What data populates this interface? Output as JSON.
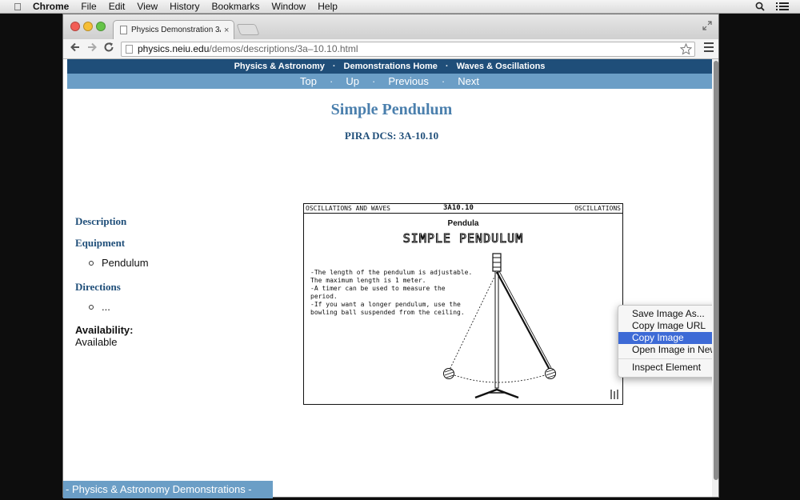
{
  "menubar": {
    "app": "Chrome",
    "items": [
      "File",
      "Edit",
      "View",
      "History",
      "Bookmarks",
      "Window",
      "Help"
    ]
  },
  "browser": {
    "tab_title": "Physics Demonstration 3A",
    "tab_close": "×",
    "url_host": "physics.neiu.edu",
    "url_path": "/demos/descriptions/3a–10.10.html"
  },
  "page": {
    "nav_top": [
      "Physics & Astronomy",
      "Demonstrations Home",
      "Waves & Oscillations"
    ],
    "nav_bottom": [
      "Top",
      "Up",
      "Previous",
      "Next"
    ],
    "title": "Simple Pendulum",
    "pira": "PIRA DCS: 3A-10.10",
    "description_head": "Description",
    "equipment_head": "Equipment",
    "equipment_item": "Pendulum",
    "directions_head": "Directions",
    "directions_item": "...",
    "availability_head": "Availability:",
    "availability_value": "Available",
    "footer": "- Physics & Astronomy Demonstrations -"
  },
  "figure": {
    "header_left": "OSCILLATIONS AND WAVES",
    "header_center": "3A10.10",
    "header_right": "OSCILLATIONS",
    "subheading": "Pendula",
    "title": "SIMPLE PENDULUM",
    "lines": [
      "-The length of the pendulum is adjustable.",
      "The maximum length is 1 meter.",
      "-A timer can be used to measure the",
      "period.",
      "-If you want a longer pendulum, use the",
      "bowling ball suspended from the ceiling."
    ]
  },
  "context_menu": {
    "items": [
      "Save Image As...",
      "Copy Image URL",
      "Copy Image",
      "Open Image in New Tab"
    ],
    "active_index": 2,
    "last": "Inspect Element"
  },
  "icons": [
    "apple-icon",
    "search-icon",
    "list-icon",
    "back-arrow-icon",
    "forward-arrow-icon",
    "reload-icon",
    "bookmark-star-icon",
    "chrome-menu-icon",
    "fullscreen-icon"
  ]
}
